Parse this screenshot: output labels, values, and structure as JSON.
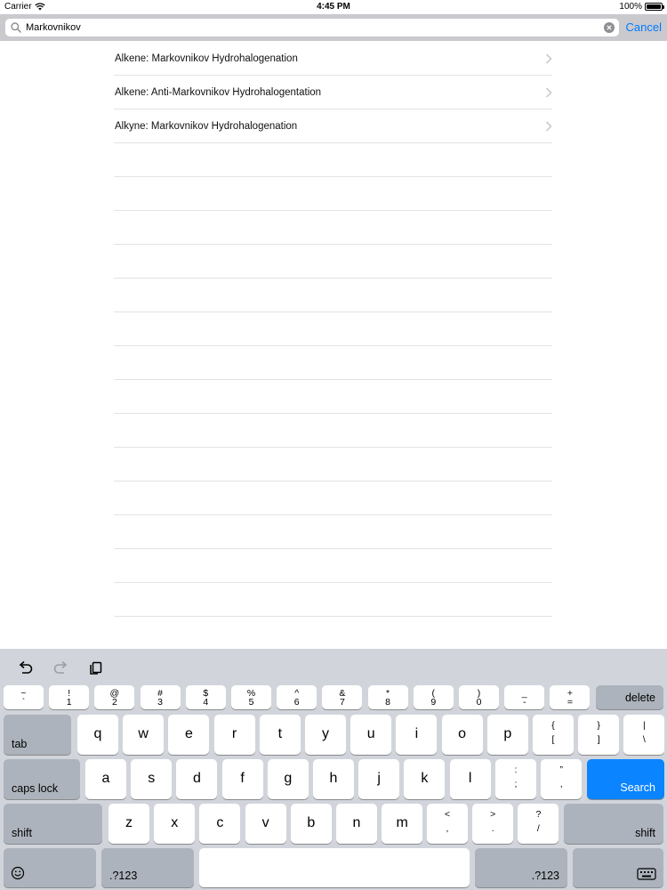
{
  "status_bar": {
    "carrier": "Carrier",
    "time": "4:45 PM",
    "battery": "100%",
    "battery_level": 1.0
  },
  "search": {
    "query": "Markovnikov",
    "cancel_label": "Cancel"
  },
  "results": [
    {
      "label": "Alkene: Markovnikov Hydrohalogenation"
    },
    {
      "label": "Alkene: Anti-Markovnikov Hydrohalogentation"
    },
    {
      "label": "Alkyne: Markovnikov Hydrohalogenation"
    }
  ],
  "keyboard": {
    "toolbar": {
      "undo": "undo-icon",
      "redo": "redo-icon",
      "paste": "paste-icon"
    },
    "number_row": [
      {
        "top": "~",
        "bottom": "`"
      },
      {
        "top": "!",
        "bottom": "1"
      },
      {
        "top": "@",
        "bottom": "2"
      },
      {
        "top": "#",
        "bottom": "3"
      },
      {
        "top": "$",
        "bottom": "4"
      },
      {
        "top": "%",
        "bottom": "5"
      },
      {
        "top": "^",
        "bottom": "6"
      },
      {
        "top": "&",
        "bottom": "7"
      },
      {
        "top": "*",
        "bottom": "8"
      },
      {
        "top": "(",
        "bottom": "9"
      },
      {
        "top": ")",
        "bottom": "0"
      },
      {
        "top": "_",
        "bottom": "-"
      },
      {
        "top": "+",
        "bottom": "="
      }
    ],
    "delete_label": "delete",
    "tab_label": "tab",
    "row_q": [
      "q",
      "w",
      "e",
      "r",
      "t",
      "y",
      "u",
      "i",
      "o",
      "p"
    ],
    "row_q_symbols": [
      {
        "top": "{",
        "bottom": "["
      },
      {
        "top": "}",
        "bottom": "]"
      },
      {
        "top": "|",
        "bottom": "\\"
      }
    ],
    "caps_label": "caps lock",
    "row_a": [
      "a",
      "s",
      "d",
      "f",
      "g",
      "h",
      "j",
      "k",
      "l"
    ],
    "row_a_symbols": [
      {
        "top": ":",
        "bottom": ";"
      },
      {
        "top": "”",
        "bottom": ","
      }
    ],
    "search_label": "Search",
    "shift_label": "shift",
    "row_z": [
      "z",
      "x",
      "c",
      "v",
      "b",
      "n",
      "m"
    ],
    "row_z_symbols": [
      {
        "top": "<",
        "bottom": ","
      },
      {
        "top": ">",
        "bottom": "."
      },
      {
        "top": "?",
        "bottom": "/"
      }
    ],
    "numbers_label": ".?123",
    "emoji_icon": "emoji-icon",
    "hide_keyboard_icon": "keyboard-dismiss-icon",
    "search_key_color": "#0a84ff"
  }
}
